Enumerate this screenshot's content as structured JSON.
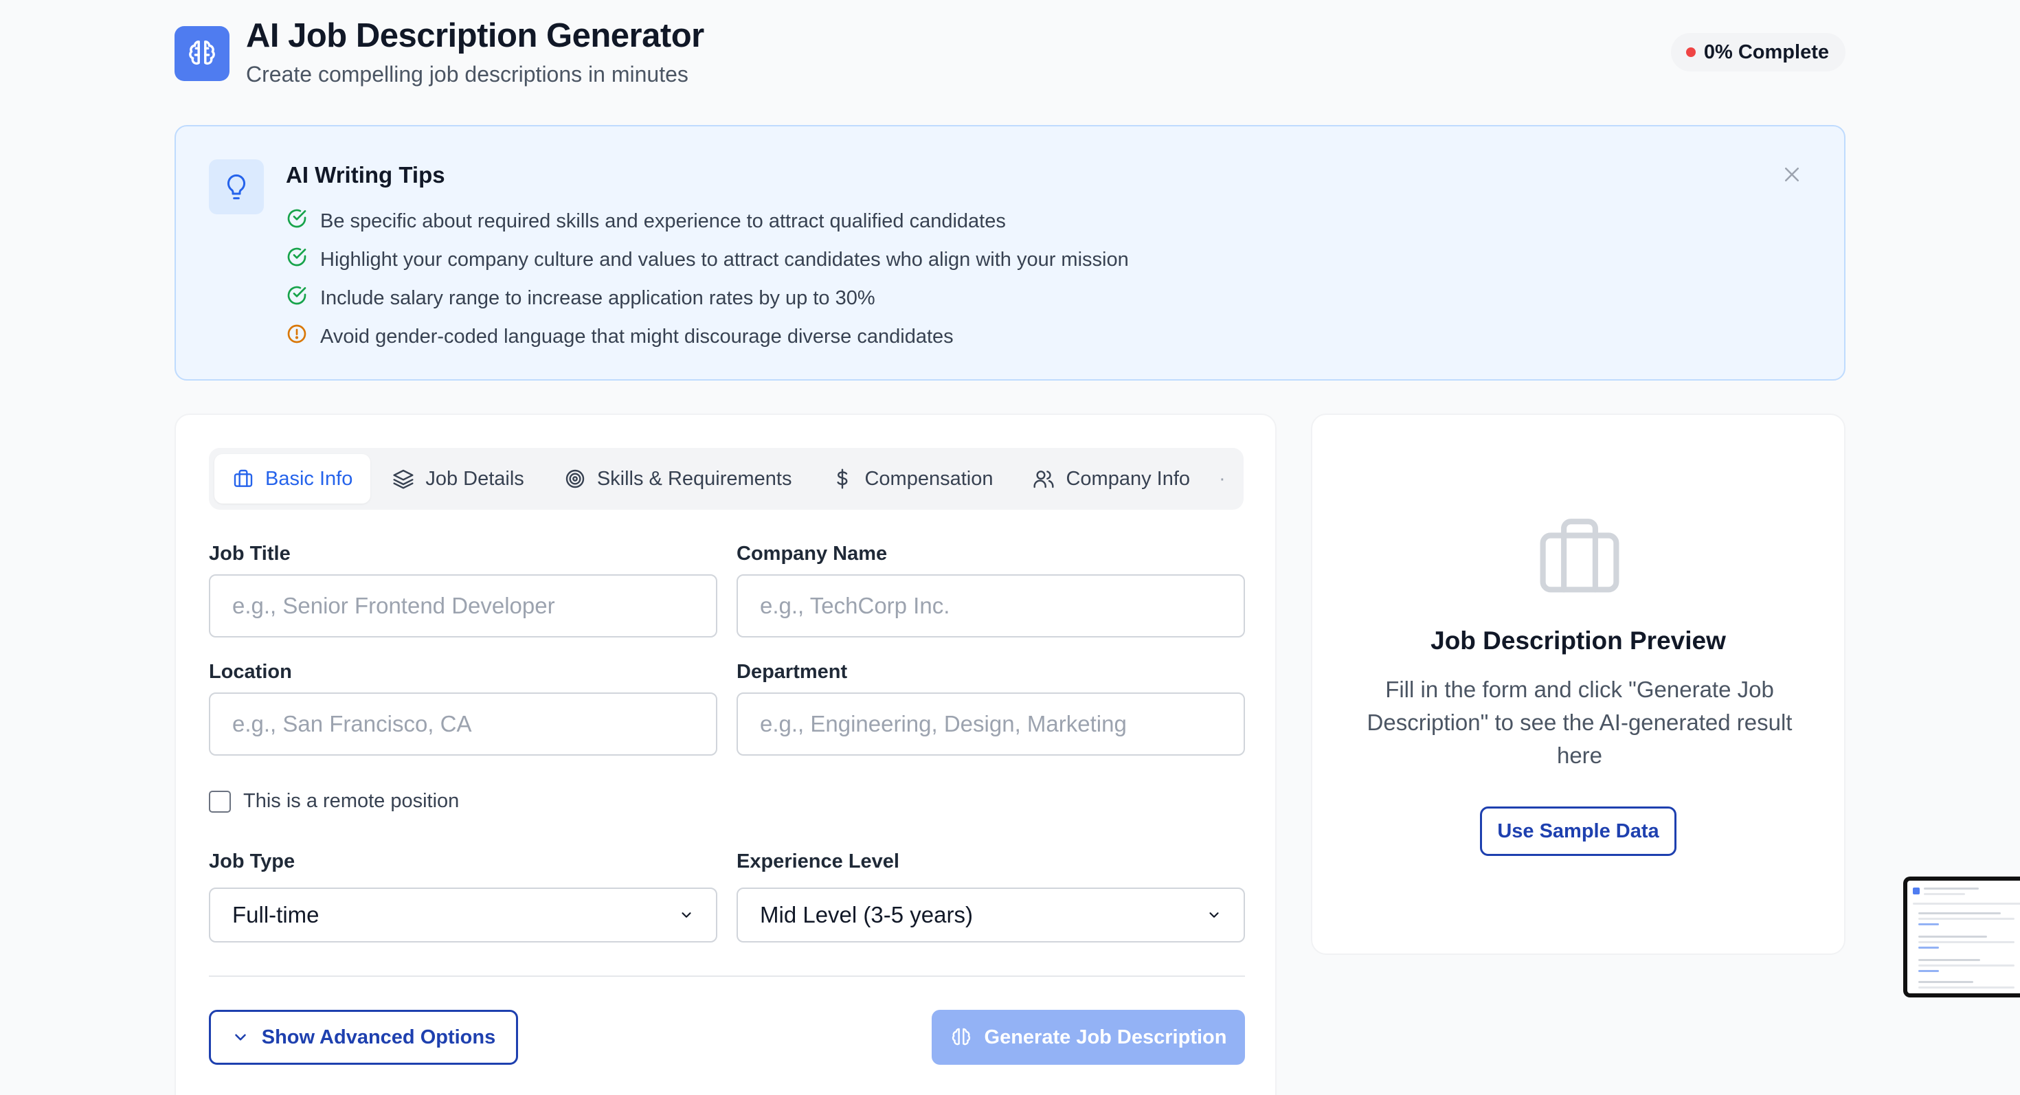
{
  "header": {
    "title": "AI Job Description Generator",
    "subtitle": "Create compelling job descriptions in minutes",
    "progress": "0% Complete",
    "progress_color": "#ef4444",
    "logo_icon": "brain-icon",
    "accent_color": "#4f7cf0"
  },
  "tips": {
    "title": "AI Writing Tips",
    "icon": "lightbulb-icon",
    "items": [
      {
        "text": "Be specific about required skills and experience to attract qualified candidates",
        "icon": "check-circle-icon"
      },
      {
        "text": "Highlight your company culture and values to attract candidates who align with your mission",
        "icon": "check-circle-icon"
      },
      {
        "text": "Include salary range to increase application rates by up to 30%",
        "icon": "check-circle-icon"
      },
      {
        "text": "Avoid gender-coded language that might discourage diverse candidates",
        "icon": "alert-circle-icon"
      }
    ]
  },
  "tabs": [
    {
      "label": "Basic Info",
      "icon": "briefcase-icon",
      "active": true
    },
    {
      "label": "Job Details",
      "icon": "layers-icon",
      "active": false
    },
    {
      "label": "Skills & Requirements",
      "icon": "target-icon",
      "active": false
    },
    {
      "label": "Compensation",
      "icon": "dollar-icon",
      "active": false
    },
    {
      "label": "Company Info",
      "icon": "users-icon",
      "active": false
    }
  ],
  "form": {
    "job_title": {
      "label": "Job Title",
      "placeholder": "e.g., Senior Frontend Developer",
      "value": ""
    },
    "company_name": {
      "label": "Company Name",
      "placeholder": "e.g., TechCorp Inc.",
      "value": ""
    },
    "location": {
      "label": "Location",
      "placeholder": "e.g., San Francisco, CA",
      "value": ""
    },
    "department": {
      "label": "Department",
      "placeholder": "e.g., Engineering, Design, Marketing",
      "value": ""
    },
    "remote_label": "This is a remote position",
    "job_type": {
      "label": "Job Type",
      "value": "Full-time"
    },
    "experience_level": {
      "label": "Experience Level",
      "value": "Mid Level (3-5 years)"
    },
    "advanced_button": "Show Advanced Options",
    "generate_button": "Generate Job Description"
  },
  "preview": {
    "title": "Job Description Preview",
    "description": "Fill in the form and click \"Generate Job Description\" to see the AI-generated result here",
    "sample_button": "Use Sample Data"
  }
}
